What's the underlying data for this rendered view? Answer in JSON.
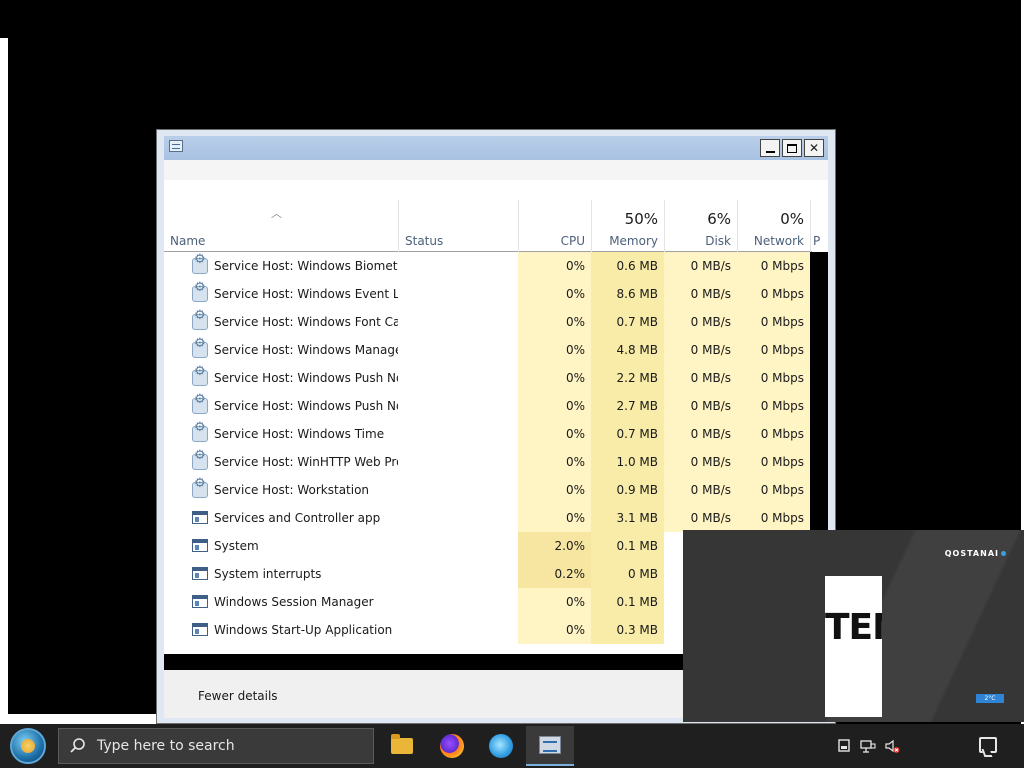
{
  "columns": {
    "name": "Name",
    "status": "Status",
    "cpu": "CPU",
    "memory": "Memory",
    "memory_pct": "50%",
    "disk": "Disk",
    "disk_pct": "6%",
    "network": "Network",
    "network_pct": "0%",
    "power": "P"
  },
  "rows": [
    {
      "name": "Service Host: Windows Biometri...",
      "icon": "gear-icon",
      "cpu": "0%",
      "memory": "0.6 MB",
      "disk": "0 MB/s",
      "network": "0 Mbps"
    },
    {
      "name": "Service Host: Windows Event Log",
      "icon": "gear-icon",
      "cpu": "0%",
      "memory": "8.6 MB",
      "disk": "0 MB/s",
      "network": "0 Mbps"
    },
    {
      "name": "Service Host: Windows Font Ca...",
      "icon": "gear-icon",
      "cpu": "0%",
      "memory": "0.7 MB",
      "disk": "0 MB/s",
      "network": "0 Mbps"
    },
    {
      "name": "Service Host: Windows Manage...",
      "icon": "gear-icon",
      "cpu": "0%",
      "memory": "4.8 MB",
      "disk": "0 MB/s",
      "network": "0 Mbps"
    },
    {
      "name": "Service Host: Windows Push No...",
      "icon": "gear-icon",
      "cpu": "0%",
      "memory": "2.2 MB",
      "disk": "0 MB/s",
      "network": "0 Mbps"
    },
    {
      "name": "Service Host: Windows Push No...",
      "icon": "gear-icon",
      "cpu": "0%",
      "memory": "2.7 MB",
      "disk": "0 MB/s",
      "network": "0 Mbps"
    },
    {
      "name": "Service Host: Windows Time",
      "icon": "gear-icon",
      "cpu": "0%",
      "memory": "0.7 MB",
      "disk": "0 MB/s",
      "network": "0 Mbps"
    },
    {
      "name": "Service Host: WinHTTP Web Pro...",
      "icon": "gear-icon",
      "cpu": "0%",
      "memory": "1.0 MB",
      "disk": "0 MB/s",
      "network": "0 Mbps"
    },
    {
      "name": "Service Host: Workstation",
      "icon": "gear-icon",
      "cpu": "0%",
      "memory": "0.9 MB",
      "disk": "0 MB/s",
      "network": "0 Mbps"
    },
    {
      "name": "Services and Controller app",
      "icon": "app-window-icon",
      "cpu": "0%",
      "memory": "3.1 MB",
      "disk": "0 MB/s",
      "network": "0 Mbps"
    },
    {
      "name": "System",
      "icon": "app-window-icon",
      "cpu": "2.0%",
      "memory": "0.1 MB",
      "disk": "",
      "network": ""
    },
    {
      "name": "System interrupts",
      "icon": "app-window-icon",
      "cpu": "0.2%",
      "memory": "0 MB",
      "disk": "",
      "network": ""
    },
    {
      "name": "Windows Session Manager",
      "icon": "app-window-icon",
      "cpu": "0%",
      "memory": "0.1 MB",
      "disk": "",
      "network": ""
    },
    {
      "name": "Windows Start-Up Application",
      "icon": "app-window-icon",
      "cpu": "0%",
      "memory": "0.3 MB",
      "disk": "",
      "network": ""
    }
  ],
  "footer": {
    "fewer_details": "Fewer details"
  },
  "overlay": {
    "brand": "QOSTANAI",
    "big_text": "TEN",
    "tag": "2°C"
  },
  "taskbar": {
    "search_placeholder": "Type here to search",
    "apps": [
      "file-explorer-icon",
      "firefox-icon",
      "browser-icon",
      "task-manager-icon"
    ]
  },
  "colors": {
    "cpu_heat_low": "#fff4c4",
    "cpu_heat_mid": "#f9eca8",
    "taskbar": "#1f1f1f",
    "accent": "#7bb0e0"
  }
}
